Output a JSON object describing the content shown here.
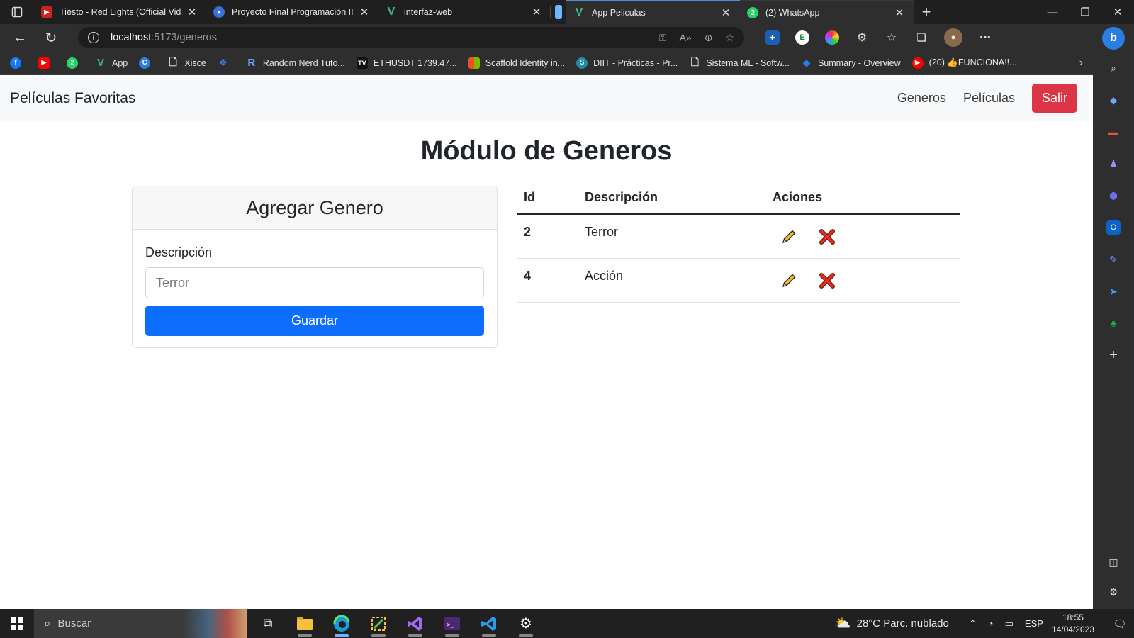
{
  "browser": {
    "tabs": [
      {
        "title": "Tiësto - Red Lights (Official Video",
        "favicon_color": "#cc2222"
      },
      {
        "title": "Proyecto Final Programación II",
        "favicon_color": "#3b6fd9"
      },
      {
        "title": "interfaz-web",
        "favicon_color": "#41b883"
      },
      {
        "title": "App Peliculas",
        "favicon_color": "#41b883"
      },
      {
        "title": "(2) WhatsApp",
        "favicon_color": "#25d366"
      }
    ],
    "active_tab_index": 3,
    "url_host": "localhost",
    "url_path": ":5173/generos",
    "bookmarks": [
      {
        "label": "",
        "color": "#1877f2"
      },
      {
        "label": "",
        "color": "#ff0000"
      },
      {
        "label": "",
        "color": "#25d366"
      },
      {
        "label": "App",
        "color": "#41b883"
      },
      {
        "label": "",
        "color": "#2a7de1"
      },
      {
        "label": "Xisce",
        "color": "#5a5a5a"
      },
      {
        "label": "",
        "color": "#3b82f6"
      },
      {
        "label": "Random Nerd Tuto...",
        "color": "#2a5db0"
      },
      {
        "label": "ETHUSDT 1739.47...",
        "color": "#111111"
      },
      {
        "label": "Scaffold Identity in...",
        "color": "#f25022"
      },
      {
        "label": "DIIT - Prácticas - Pr...",
        "color": "#1f8aa8"
      },
      {
        "label": "Sistema ML - Softw...",
        "color": "#5a5a5a"
      },
      {
        "label": "Summary - Overview",
        "color": "#2a7de1"
      },
      {
        "label": "(20) 👍FUNCIONA!!...",
        "color": "#ff0000"
      }
    ]
  },
  "app": {
    "brand": "Películas Favoritas",
    "nav": {
      "generos": "Generos",
      "peliculas": "Películas",
      "salir": "Salir"
    },
    "page_title": "Módulo de Generos",
    "form": {
      "title": "Agregar Genero",
      "label": "Descripción",
      "placeholder": "Terror",
      "value": "",
      "submit": "Guardar"
    },
    "table": {
      "headers": {
        "id": "Id",
        "descripcion": "Descripción",
        "acciones": "Aciones"
      },
      "rows": [
        {
          "id": "2",
          "descripcion": "Terror"
        },
        {
          "id": "4",
          "descripcion": "Acción"
        }
      ]
    }
  },
  "taskbar": {
    "search_placeholder": "Buscar",
    "weather": "28°C  Parc. nublado",
    "language": "ESP",
    "time": "18:55",
    "date": "14/04/2023"
  }
}
